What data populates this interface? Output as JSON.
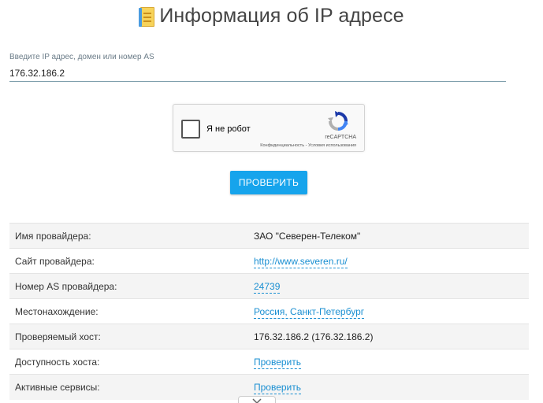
{
  "header": {
    "title": "Информация об IP адресе",
    "icon": "notepad-icon"
  },
  "lookup": {
    "label": "Введите IP адрес, домен или номер AS",
    "value": "176.32.186.2"
  },
  "captcha": {
    "label": "Я не робот",
    "brand": "reCAPTCHA",
    "links": "Конфиденциальность - Условия использования"
  },
  "submit": {
    "label": "ПРОВЕРИТЬ",
    "color": "#16a4ec"
  },
  "info": {
    "rows": [
      {
        "label": "Имя провайдера:",
        "value": "ЗАО \"Северен-Телеком\"",
        "link": false
      },
      {
        "label": "Сайт провайдера:",
        "value": "http://www.severen.ru/",
        "link": true
      },
      {
        "label": "Номер AS провайдера:",
        "value": "24739",
        "link": true
      },
      {
        "label": "Местонахождение:",
        "value": "Россия, Санкт-Петербург",
        "link": true
      },
      {
        "label": "Проверяемый хост:",
        "value": "176.32.186.2 (176.32.186.2)",
        "link": false
      },
      {
        "label": "Доступность хоста:",
        "value": "Проверить",
        "link": true
      },
      {
        "label": "Активные сервисы:",
        "value": "Проверить",
        "link": true
      }
    ]
  },
  "colors": {
    "link": "#1a8fd2",
    "accent": "#16a4ec"
  }
}
